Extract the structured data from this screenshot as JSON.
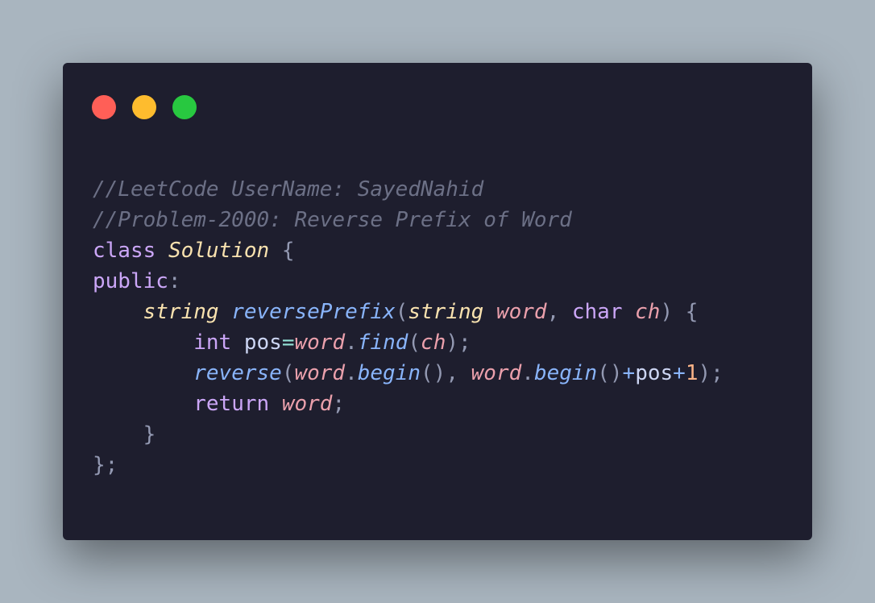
{
  "window": {
    "controls": [
      {
        "name": "close",
        "color": "#ff5f57"
      },
      {
        "name": "minimize",
        "color": "#febc2e"
      },
      {
        "name": "maximize",
        "color": "#28c840"
      }
    ]
  },
  "code": {
    "lines": [
      [
        {
          "t": "//LeetCode UserName: SayedNahid",
          "k": "comment"
        }
      ],
      [
        {
          "t": "//Problem-2000: Reverse Prefix of Word",
          "k": "comment"
        }
      ],
      [
        {
          "t": "class",
          "k": "keyword"
        },
        {
          "t": " ",
          "k": "plain"
        },
        {
          "t": "Solution",
          "k": "class-name"
        },
        {
          "t": " {",
          "k": "punct"
        }
      ],
      [
        {
          "t": "public",
          "k": "keyword"
        },
        {
          "t": ":",
          "k": "punct"
        }
      ],
      [
        {
          "t": "    ",
          "k": "plain"
        },
        {
          "t": "string",
          "k": "type-italic"
        },
        {
          "t": " ",
          "k": "plain"
        },
        {
          "t": "reversePrefix",
          "k": "func"
        },
        {
          "t": "(",
          "k": "punct"
        },
        {
          "t": "string",
          "k": "type-italic"
        },
        {
          "t": " ",
          "k": "plain"
        },
        {
          "t": "word",
          "k": "param"
        },
        {
          "t": ",",
          "k": "punct"
        },
        {
          "t": " ",
          "k": "plain"
        },
        {
          "t": "char",
          "k": "keyword"
        },
        {
          "t": " ",
          "k": "plain"
        },
        {
          "t": "ch",
          "k": "param"
        },
        {
          "t": ") {",
          "k": "punct"
        }
      ],
      [
        {
          "t": "        ",
          "k": "plain"
        },
        {
          "t": "int",
          "k": "keyword"
        },
        {
          "t": " ",
          "k": "plain"
        },
        {
          "t": "pos",
          "k": "plain"
        },
        {
          "t": "=",
          "k": "op"
        },
        {
          "t": "word",
          "k": "param"
        },
        {
          "t": ".",
          "k": "punct"
        },
        {
          "t": "find",
          "k": "func"
        },
        {
          "t": "(",
          "k": "punct"
        },
        {
          "t": "ch",
          "k": "param"
        },
        {
          "t": ");",
          "k": "punct"
        }
      ],
      [
        {
          "t": "        ",
          "k": "plain"
        },
        {
          "t": "reverse",
          "k": "func"
        },
        {
          "t": "(",
          "k": "punct"
        },
        {
          "t": "word",
          "k": "param"
        },
        {
          "t": ".",
          "k": "punct"
        },
        {
          "t": "begin",
          "k": "func"
        },
        {
          "t": "(), ",
          "k": "punct"
        },
        {
          "t": "word",
          "k": "param"
        },
        {
          "t": ".",
          "k": "punct"
        },
        {
          "t": "begin",
          "k": "func"
        },
        {
          "t": "()",
          "k": "punct"
        },
        {
          "t": "+",
          "k": "op2"
        },
        {
          "t": "pos",
          "k": "plain"
        },
        {
          "t": "+",
          "k": "op2"
        },
        {
          "t": "1",
          "k": "num"
        },
        {
          "t": ");",
          "k": "punct"
        }
      ],
      [
        {
          "t": "        ",
          "k": "plain"
        },
        {
          "t": "return",
          "k": "keyword"
        },
        {
          "t": " ",
          "k": "plain"
        },
        {
          "t": "word",
          "k": "param"
        },
        {
          "t": ";",
          "k": "punct"
        }
      ],
      [
        {
          "t": "    }",
          "k": "punct"
        }
      ],
      [
        {
          "t": "};",
          "k": "punct"
        }
      ]
    ]
  }
}
